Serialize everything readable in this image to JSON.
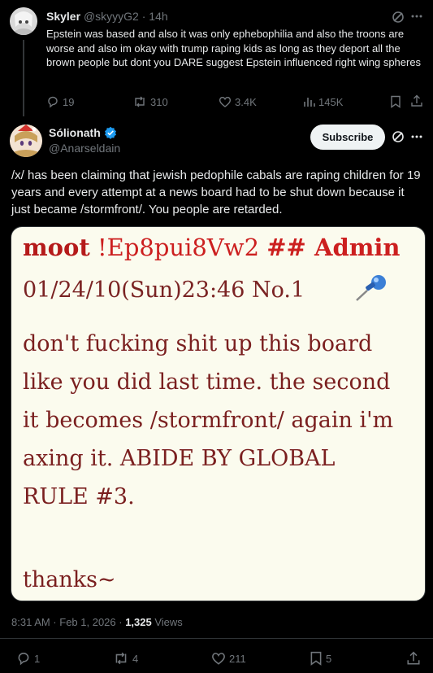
{
  "parent_tweet": {
    "name": "Skyler",
    "handle": "@skyyyG2",
    "time": "14h",
    "text": "Epstein was based and also it was only ephebophilia and also the troons are worse and also im okay with trump raping kids as long as they deport all the brown people but dont you DARE suggest Epstein influenced right wing spheres",
    "stats": {
      "replies": "19",
      "retweets": "310",
      "likes": "3.4K",
      "views": "145K"
    }
  },
  "main_tweet": {
    "name": "Sólionath",
    "handle": "@Anarseldain",
    "subscribe_label": "Subscribe",
    "text": "/x/ has been claiming that jewish pedophile cabals are raping children for 19 years and every attempt at a news board had to be shut down because it just became /stormfront/. You people are retarded.",
    "image": {
      "header_name": "moot",
      "header_trip": "!Ep8pui8Vw2",
      "header_role": "## Admin",
      "date_line": "01/24/10(Sun)23:46 No.1",
      "body_lines": [
        "don't fucking shit up this board",
        "like you did last time. the second",
        "it becomes /stormfront/ again i'm",
        "axing it. ABIDE BY GLOBAL",
        "RULE #3."
      ],
      "signoff": "thanks~"
    },
    "meta": {
      "time": "8:31 AM · Feb 1, 2026 · ",
      "views_count": "1,325",
      "views_label": " Views"
    },
    "stats": {
      "replies": "1",
      "retweets": "4",
      "likes": "211",
      "bookmarks": "5"
    }
  },
  "colors": {
    "background": "#000000",
    "text": "#e7e9ea",
    "muted": "#71767b",
    "verified": "#1d9bf0",
    "image_bg": "#fbfbee",
    "image_text": "#7a1f1f"
  }
}
